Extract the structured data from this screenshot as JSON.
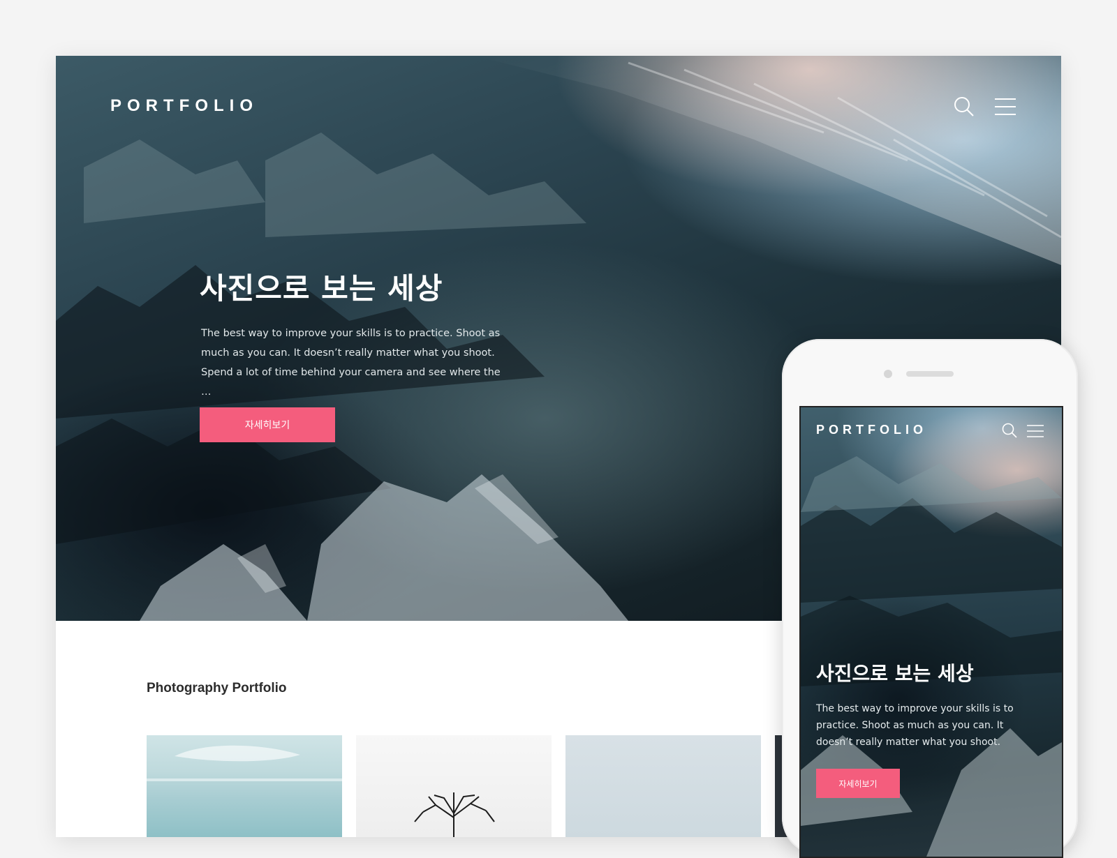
{
  "desktop": {
    "nav": {
      "logo": "PORTFOLIO",
      "search_icon": "search-icon",
      "menu_icon": "hamburger-menu-icon"
    },
    "hero": {
      "title": "사진으로 보는 세상",
      "description": "The best way to improve your skills is to practice. Shoot as much as you can. It doesn’t really matter what you shoot. Spend a lot of time behind your camera and see where the …",
      "button_label": "자세히보기"
    },
    "section": {
      "title": "Photography Portfolio"
    }
  },
  "mobile": {
    "nav": {
      "logo": "PORTFOLIO",
      "search_icon": "search-icon",
      "menu_icon": "hamburger-menu-icon"
    },
    "hero": {
      "title": "사진으로 보는 세상",
      "description": "The best way to improve your skills is to practice. Shoot as much as you can. It doesn’t really matter what you shoot.",
      "button_label": "자세히보기"
    }
  },
  "colors": {
    "accent": "#f45d7d",
    "page_background": "#f4f4f4",
    "heading_text": "#2c2c2c"
  }
}
